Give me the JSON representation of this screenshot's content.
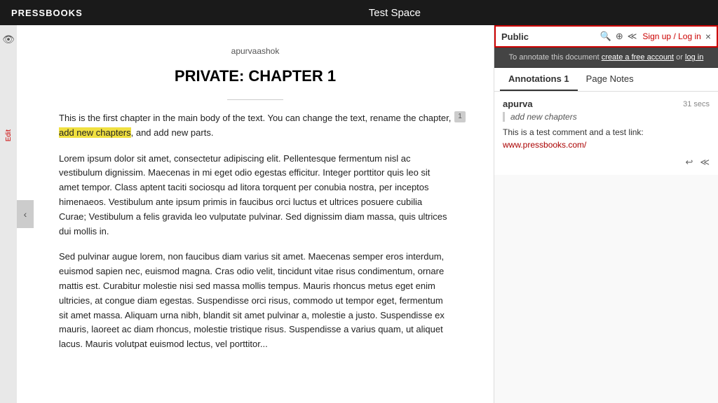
{
  "topnav": {
    "brand": "PRESSBOOKS",
    "title": "Test Space"
  },
  "content": {
    "username": "apurvaashok",
    "chapter_title": "PRIVATE: CHAPTER 1",
    "paragraph1": "This is the first chapter in the main body of the text. You can change the text, rename the chapter, ",
    "paragraph1_highlight": "add new chapters",
    "paragraph1_end": ", and add new parts.",
    "paragraph2": "Lorem ipsum dolor sit amet, consectetur adipiscing elit. Pellentesque fermentum nisl ac vestibulum dignissim. Maecenas in mi eget odio egestas efficitur. Integer porttitor quis leo sit amet tempor. Class aptent taciti sociosqu ad litora torquent per conubia nostra, per inceptos himenaeos. Vestibulum ante ipsum primis in faucibus orci luctus et ultrices posuere cubilia Curae; Vestibulum a felis gravida leo vulputate pulvinar. Sed dignissim diam massa, quis ultrices dui mollis in.",
    "paragraph3": "Sed pulvinar augue lorem, non faucibus diam varius sit amet. Maecenas semper eros interdum, euismod sapien nec, euismod magna. Cras odio velit, tincidunt vitae risus condimentum, ornare mattis est. Curabitur molestie nisi sed massa mollis tempus. Mauris rhoncus metus eget enim ultricies, at congue diam egestas. Suspendisse orci risus, commodo ut tempor eget, fermentum sit amet massa. Aliquam urna nibh, blandit sit amet pulvinar a, molestie a justo. Suspendisse ex mauris, laoreet ac diam rhoncus, molestie tristique risus. Suspendisse a varius quam, ut aliquet lacus. Mauris volutpat euismod lectus, vel porttitor...",
    "annotation_number": "1",
    "back_button_label": "‹"
  },
  "right_panel": {
    "public_label": "Public",
    "signup_text": "Sign up / Log in",
    "close_label": "×",
    "notice_text": "To annotate this document ",
    "notice_link1": "create a free account",
    "notice_middle": " or ",
    "notice_link2": "log in",
    "tabs": [
      {
        "label": "Annotations 1",
        "active": true
      },
      {
        "label": "Page Notes",
        "active": false
      }
    ],
    "annotation": {
      "user": "apurva",
      "time": "31 secs",
      "quote": "add new chapters",
      "comment": "This is a test comment and a test link: ",
      "link_text": "www.pressbooks.com/",
      "link_href": "http://www.pressbooks.com/"
    },
    "icons": {
      "search": "🔍",
      "share1": "⊕",
      "share2": "≪"
    },
    "reply_icon": "↩",
    "share_icon": "≪"
  },
  "sidebar": {
    "eye_icon": "👁",
    "edit_label": "Edit"
  }
}
